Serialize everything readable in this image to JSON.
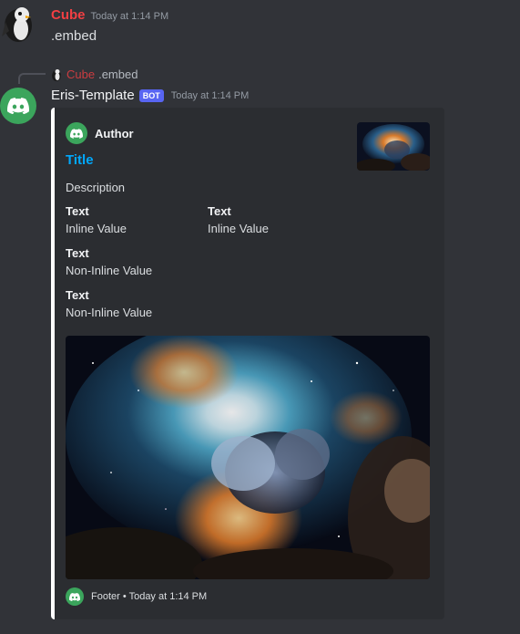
{
  "message1": {
    "username": "Cube",
    "timestamp": "Today at 1:14 PM",
    "content": ".embed"
  },
  "reply": {
    "username": "Cube",
    "content": ".embed"
  },
  "bot": {
    "name": "Eris-Template",
    "badge": "BOT",
    "timestamp": "Today at 1:14 PM"
  },
  "embed": {
    "color": "#ffffff",
    "author": "Author",
    "title": "Title",
    "description": "Description",
    "fields": [
      {
        "name": "Text",
        "value": "Inline Value",
        "inline": true
      },
      {
        "name": "Text",
        "value": "Inline Value",
        "inline": true
      },
      {
        "name": "Text",
        "value": "Non-Inline Value",
        "inline": false
      },
      {
        "name": "Text",
        "value": "Non-Inline Value",
        "inline": false
      }
    ],
    "footer": "Footer",
    "footer_separator": "•",
    "footer_timestamp": "Today at 1:14 PM"
  },
  "icons": {
    "user_avatar": "penguin-avatar-icon",
    "bot_avatar": "discord-logo-icon"
  },
  "colors": {
    "username_red": "#f23f43",
    "bot_badge": "#5865f2",
    "title_link": "#00a8fc",
    "bot_avatar_bg": "#3ba55c"
  }
}
